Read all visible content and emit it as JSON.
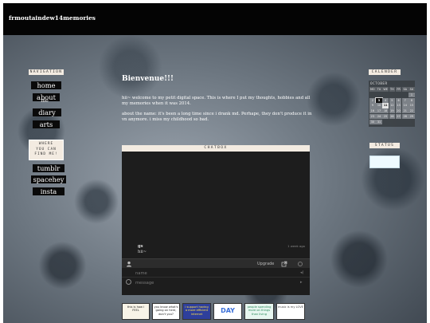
{
  "header": {
    "title": "frmoutaindew14memories"
  },
  "left": {
    "navigation_label": "NAVIGATION",
    "nav_items": [
      "home",
      "about",
      "me",
      "diary",
      "arts"
    ],
    "where_label": [
      "WHERE",
      "YOU CAN",
      "FIND ME!"
    ],
    "social_items": [
      "tumblr",
      "spacehey",
      "insta"
    ]
  },
  "main": {
    "heading": "Bienvenue!!!",
    "paragraph_1": "hii~ welcome to my petit digital space. This is where I put my thoughts, hobbies and all my memories when it was 2014.",
    "paragraph_2": "about the name: it's been a long time since i drank md. Perhape, they don't produce it in vn anymore. i miss my childhood so bad."
  },
  "chatbox": {
    "label": "CHATBOX",
    "message": {
      "name": "gs",
      "text": "hii~",
      "time": "1 week ago"
    },
    "upgrade_label": "Upgrade",
    "name_placeholder": "name",
    "message_placeholder": "message"
  },
  "right": {
    "calendar_label": "CALENDER",
    "calendar": {
      "month": "OCTOBER",
      "weekdays": [
        "MO",
        "TU",
        "WE",
        "TH",
        "FR",
        "SA",
        "SU"
      ],
      "days": [
        "",
        "",
        "",
        "",
        "",
        "",
        "1",
        "2",
        "3",
        "4",
        "5",
        "6",
        "7",
        "8",
        "9",
        "10",
        "11",
        "12",
        "13",
        "14",
        "15",
        "16",
        "17",
        "18",
        "19",
        "20",
        "21",
        "22",
        "23",
        "24",
        "25",
        "26",
        "27",
        "28",
        "29",
        "30",
        "31"
      ],
      "today": "3",
      "marked": "11"
    },
    "status_label": "STATUS"
  },
  "stamps": [
    {
      "text": "this is how i FEEL",
      "bg": "#f8f4e8",
      "color": "#222"
    },
    {
      "text": "you know what's going on here, don't you?",
      "bg": "#ffffff",
      "color": "#222"
    },
    {
      "text": "i support having a more efficient internet",
      "bg": "#2e3f9c",
      "color": "#ffe14a"
    },
    {
      "text": "DAY",
      "bg": "#ffffff",
      "color": "#3a6fd8"
    },
    {
      "text": "people spending more on things than living",
      "bg": "#e8f6f0",
      "color": "#2a8a5a"
    },
    {
      "text": "music is my LOVE",
      "bg": "#ffffff",
      "color": "#444"
    }
  ]
}
